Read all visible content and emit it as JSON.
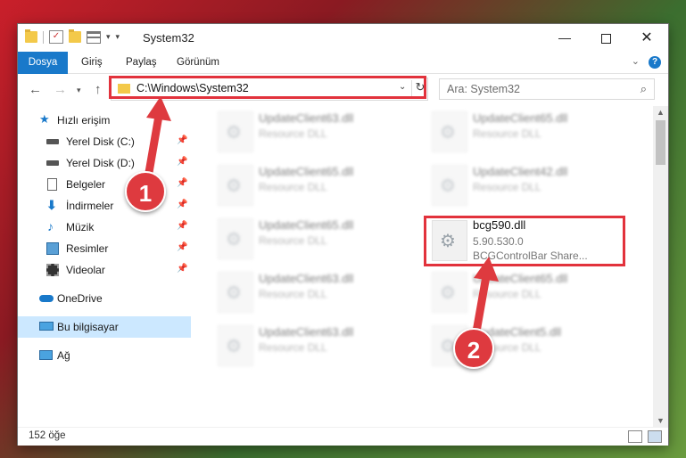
{
  "window": {
    "title": "System32",
    "controls": {
      "minimize": "—",
      "maximize": "",
      "close": "✕"
    }
  },
  "quick_access": {
    "dropdown": "▾",
    "props_dropdown": "▾"
  },
  "ribbon": {
    "tabs": [
      "Dosya",
      "Giriş",
      "Paylaş",
      "Görünüm"
    ],
    "collapse": "⌄",
    "help": "?"
  },
  "navigation": {
    "back": "←",
    "forward": "→",
    "recent": "▾",
    "up": "↑",
    "address": "C:\\Windows\\System32",
    "address_dropdown": "⌄",
    "refresh": "↻",
    "search_placeholder": "Ara: System32",
    "search_icon": "⌕"
  },
  "sidebar": {
    "items": [
      {
        "label": "Hızlı erişim",
        "icon": "star-icon"
      },
      {
        "label": "Yerel Disk (C:)",
        "icon": "drive-icon",
        "pinned": true
      },
      {
        "label": "Yerel Disk (D:)",
        "icon": "drive-icon",
        "pinned": true
      },
      {
        "label": "Belgeler",
        "icon": "documents-icon",
        "pinned": true
      },
      {
        "label": "İndirmeler",
        "icon": "downloads-icon",
        "pinned": true
      },
      {
        "label": "Müzik",
        "icon": "music-icon",
        "pinned": true
      },
      {
        "label": "Resimler",
        "icon": "pictures-icon",
        "pinned": true
      },
      {
        "label": "Videolar",
        "icon": "videos-icon",
        "pinned": true
      },
      {
        "label": "OneDrive",
        "icon": "cloud-icon"
      },
      {
        "label": "Bu bilgisayar",
        "icon": "computer-icon",
        "selected": true
      },
      {
        "label": "Ağ",
        "icon": "network-icon"
      }
    ],
    "pin_glyph": "📌"
  },
  "files": [
    {
      "name": "UpdateClient63.dll",
      "desc": "Resource DLL",
      "blurred": true
    },
    {
      "name": "UpdateClient65.dll",
      "desc": "Resource DLL",
      "blurred": true
    },
    {
      "name": "UpdateClient65.dll",
      "desc": "Resource DLL",
      "blurred": true
    },
    {
      "name": "UpdateClient42.dll",
      "desc": "Resource DLL",
      "blurred": true
    },
    {
      "name": "UpdateClient65.dll",
      "desc": "Resource DLL",
      "blurred": true
    },
    {
      "name": "bcg590.dll",
      "desc": "5.90.530.0",
      "desc2": "BCGControlBar Share...",
      "blurred": false
    },
    {
      "name": "UpdateClient63.dll",
      "desc": "Resource DLL",
      "blurred": true
    },
    {
      "name": "UpdateClient65.dll",
      "desc": "Resource DLL",
      "blurred": true
    },
    {
      "name": "UpdateClient63.dll",
      "desc": "Resource DLL",
      "blurred": true
    },
    {
      "name": "UpdateClient5.dll",
      "desc": "Resource DLL",
      "blurred": true
    }
  ],
  "status": {
    "count": "152 öğe"
  },
  "annotations": {
    "step1": "1",
    "step2": "2",
    "color": "#de3a3f"
  }
}
